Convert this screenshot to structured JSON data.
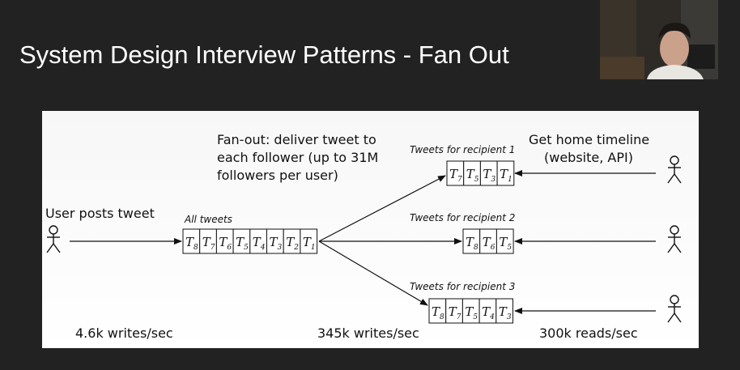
{
  "slide": {
    "title": "System Design Interview Patterns - Fan Out"
  },
  "diagram": {
    "user_label": "User posts tweet",
    "fanout_lines": [
      "Fan-out: deliver tweet to",
      "each follower (up to 31M",
      "followers per user)"
    ],
    "timeline_lines": [
      "Get home timeline",
      "(website, API)"
    ],
    "all_tweets_caption": "All tweets",
    "all_tweets": [
      "8",
      "7",
      "6",
      "5",
      "4",
      "3",
      "2",
      "1"
    ],
    "recipients": [
      {
        "caption": "Tweets for recipient 1",
        "tweets": [
          "7",
          "5",
          "3",
          "1"
        ]
      },
      {
        "caption": "Tweets for recipient 2",
        "tweets": [
          "8",
          "6",
          "5"
        ]
      },
      {
        "caption": "Tweets for recipient 3",
        "tweets": [
          "8",
          "7",
          "5",
          "4",
          "3"
        ]
      }
    ],
    "cell_letter": "T",
    "stats": {
      "writes_in": "4.6k writes/sec",
      "fanout_writes": "345k writes/sec",
      "reads": "300k reads/sec"
    }
  },
  "webcam": {
    "icon": "presenter-webcam-icon"
  }
}
